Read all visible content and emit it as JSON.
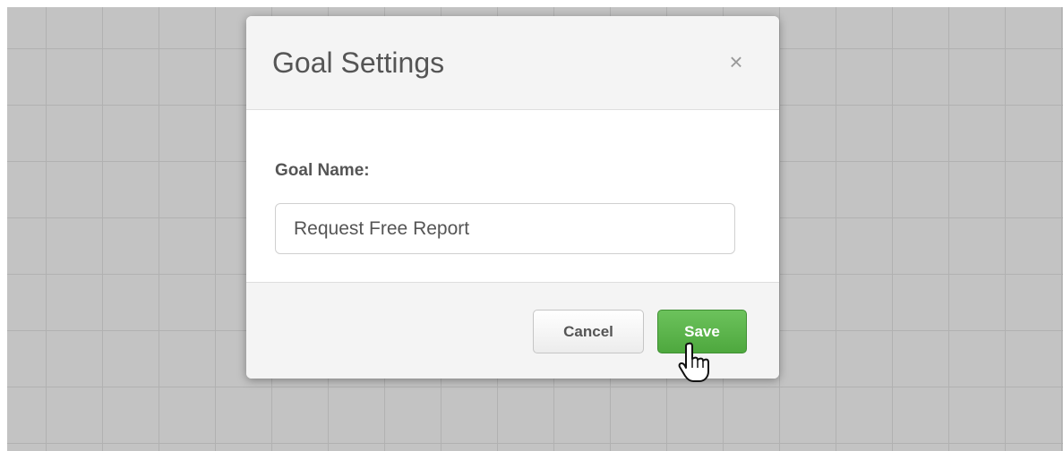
{
  "dialog": {
    "title": "Goal Settings",
    "close_glyph": "×",
    "close_icon": "close-icon",
    "field_label": "Goal Name:",
    "field_value": "Request Free Report",
    "cancel_label": "Cancel",
    "save_label": "Save"
  },
  "colors": {
    "background_grid": "#c3c3c3",
    "header_bg": "#f4f4f4",
    "save_accent": "#5cb54c",
    "text": "#555555"
  },
  "cursor": {
    "icon": "hand-pointer-icon"
  }
}
